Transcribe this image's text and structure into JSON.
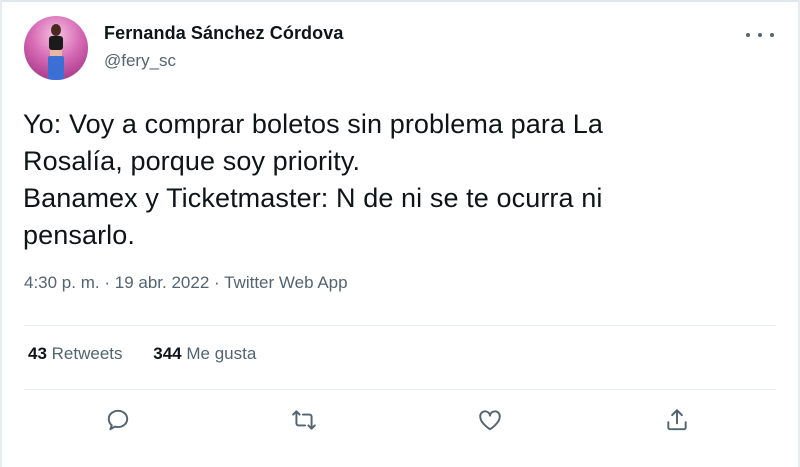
{
  "author": {
    "display_name": "Fernanda Sánchez Córdova",
    "handle": "@fery_sc",
    "avatar_icon": "profile-photo"
  },
  "tweet": {
    "lines": [
      "Yo: Voy a comprar boletos sin problema para La",
      "Rosalía, porque soy priority.",
      "Banamex y Ticketmaster: N de ni se te ocurra ni",
      "pensarlo."
    ],
    "time": "4:30 p. m.",
    "date": "19 abr. 2022",
    "source": "Twitter Web App",
    "separator": "·"
  },
  "stats": {
    "retweets_count": "43",
    "retweets_label": "Retweets",
    "likes_count": "344",
    "likes_label": "Me gusta"
  },
  "actions": [
    "reply-icon",
    "retweet-icon",
    "like-icon",
    "share-icon"
  ],
  "colors": {
    "text": "#0f1419",
    "secondary": "#536471",
    "divider": "#e6ecf0"
  }
}
